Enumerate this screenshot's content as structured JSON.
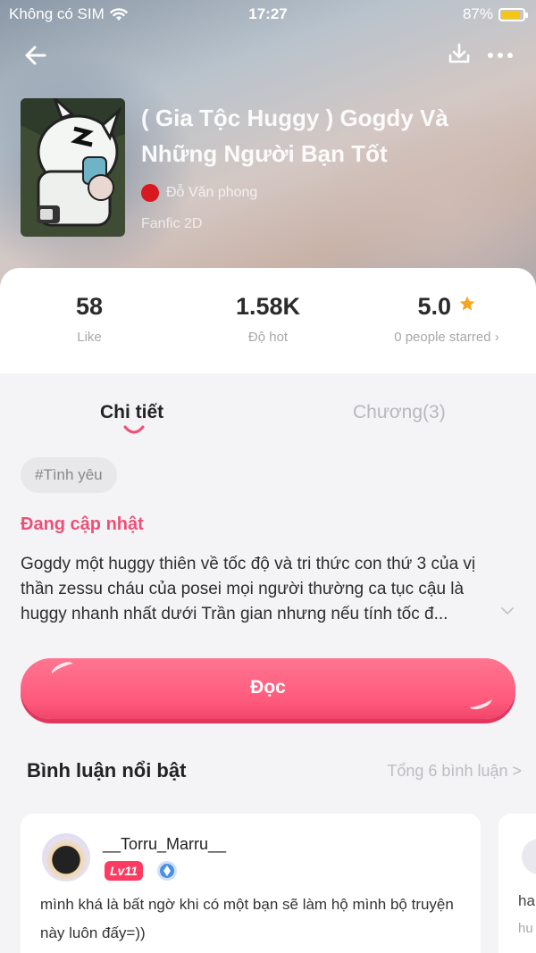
{
  "status_bar": {
    "carrier": "Không có SIM",
    "time": "17:27",
    "battery": "87%"
  },
  "book": {
    "title": "( Gia Tộc Huggy ) Gogdy Và Những Người Bạn Tốt",
    "author": "Đỗ Văn phong",
    "genre": "Fanfic 2D"
  },
  "stats": {
    "likes": "58",
    "likes_label": "Like",
    "hot": "1.58K",
    "hot_label": "Độ hot",
    "rating": "5.0",
    "rating_label": "0 people starred ›"
  },
  "tabs": [
    {
      "label": "Chi tiết",
      "active": true
    },
    {
      "label": "Chương(3)",
      "active": false
    }
  ],
  "tag": "#Tình yêu",
  "update_status": "Đang cập nhật",
  "description": "Gogdy một huggy thiên về tốc độ và tri thức con thứ 3 của vị thần zessu cháu của posei mọi người thường ca tục cậu là huggy nhanh nhất dưới Trần gian nhưng nếu tính tốc đ...",
  "read_button": "Đọc",
  "comments": {
    "title": "Bình luận nổi bật",
    "total": "Tổng 6 bình luận >",
    "items": [
      {
        "user": "__Torru_Marru__",
        "level": "Lv11",
        "text": "mình khá là bất ngờ khi có một bạn sẽ làm hộ mình bộ truyện này luôn đấy=))"
      }
    ],
    "peek": {
      "text": "ha",
      "sub": "hu"
    }
  },
  "colors": {
    "accent": "#ff5a7c",
    "status_pink": "#f04e77",
    "star": "#f6a623"
  },
  "icons": [
    "back-arrow-icon",
    "download-icon",
    "more-icon",
    "wifi-icon",
    "battery-icon",
    "star-icon",
    "chevron-down-icon",
    "smile-indicator-icon",
    "diamond-badge-icon"
  ]
}
